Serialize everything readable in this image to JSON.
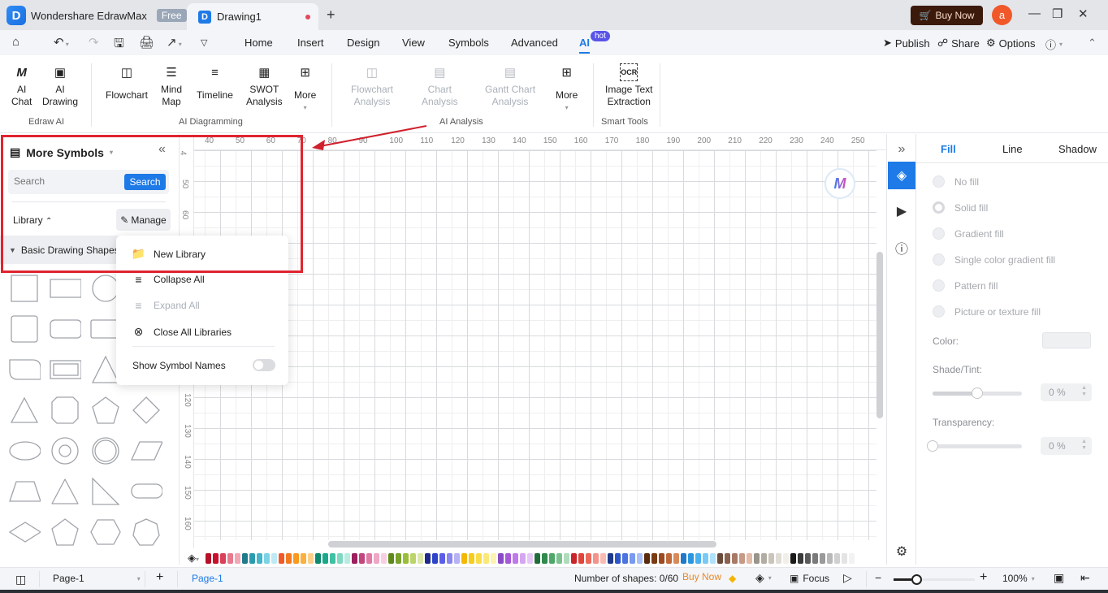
{
  "titlebar": {
    "app_name": "Wondershare EdrawMax",
    "free_badge": "Free",
    "doc_tab": "Drawing1",
    "buy_now": "Buy Now",
    "avatar_letter": "a"
  },
  "menubar": {
    "items": [
      "Home",
      "Insert",
      "Design",
      "View",
      "Symbols",
      "Advanced",
      "AI"
    ],
    "active": "AI",
    "hot_badge": "hot",
    "publish": "Publish",
    "share": "Share",
    "options": "Options"
  },
  "ribbon": {
    "edraw_ai": {
      "group": "Edraw AI",
      "ai_chat": "AI\nChat",
      "ai_chat_l1": "AI",
      "ai_chat_l2": "Chat",
      "ai_drawing_l1": "AI",
      "ai_drawing_l2": "Drawing"
    },
    "ai_diagramming": {
      "group": "AI Diagramming",
      "flowchart": "Flowchart",
      "mind_map_l1": "Mind",
      "mind_map_l2": "Map",
      "timeline": "Timeline",
      "swot_l1": "SWOT",
      "swot_l2": "Analysis",
      "more": "More"
    },
    "ai_analysis": {
      "group": "AI Analysis",
      "flowchart_l1": "Flowchart",
      "flowchart_l2": "Analysis",
      "chart_l1": "Chart",
      "chart_l2": "Analysis",
      "gantt_l1": "Gantt Chart",
      "gantt_l2": "Analysis",
      "more": "More"
    },
    "smart_tools": {
      "group": "Smart Tools",
      "ocr_l1": "Image Text",
      "ocr_l2": "Extraction"
    }
  },
  "left_panel": {
    "title": "More Symbols",
    "search_placeholder": "Search",
    "search_button": "Search",
    "library_label": "Library",
    "manage_button": "Manage",
    "library_name": "Basic Drawing Shapes"
  },
  "dropdown": {
    "items": [
      {
        "label": "New Library",
        "enabled": true
      },
      {
        "label": "Collapse All",
        "enabled": true
      },
      {
        "label": "Expand All",
        "enabled": false
      },
      {
        "label": "Close All Libraries",
        "enabled": true
      }
    ],
    "toggle_label": "Show Symbol Names",
    "toggle_on": false
  },
  "canvas": {
    "ruler_top": [
      "40",
      "50",
      "60",
      "70",
      "80",
      "90",
      "100",
      "110",
      "120",
      "130",
      "140",
      "150",
      "160",
      "170",
      "180",
      "190",
      "200",
      "210",
      "220",
      "230",
      "240",
      "250"
    ],
    "ruler_left": [
      "4",
      "50",
      "60",
      "120",
      "130",
      "140",
      "150",
      "160"
    ]
  },
  "palette": {
    "colors": [
      "#b7102a",
      "#c8102e",
      "#d9405a",
      "#e87a90",
      "#f2a7b5",
      "#1f7a8c",
      "#2a9bb0",
      "#45b5c9",
      "#7dd3e6",
      "#bfeaf5",
      "#f05a28",
      "#f47a20",
      "#f79a1e",
      "#fbb040",
      "#fcd08a",
      "#0f8a6f",
      "#19a88a",
      "#3fc1a3",
      "#7ed9c3",
      "#b8ece0",
      "#9c1f5e",
      "#c2467e",
      "#e07aa5",
      "#f0a6c6",
      "#f6d0e2",
      "#5e8a1a",
      "#7aa32a",
      "#9bbe3a",
      "#bcd46a",
      "#dbe8a8",
      "#1e2a8c",
      "#2e44c8",
      "#5a5ee8",
      "#8a86f0",
      "#b6b2f6",
      "#f5b800",
      "#f7cc1a",
      "#f9dc4a",
      "#fbe87a",
      "#fdf4b0",
      "#8a4ac8",
      "#a65ad8",
      "#c07ae8",
      "#d6a6f2",
      "#e6c8f8",
      "#1f6e3a",
      "#2f8a4e",
      "#4fa86a",
      "#7cc28e",
      "#b0dcbc",
      "#c8242a",
      "#e0443a",
      "#ec6a5c",
      "#f4938a",
      "#f9bcb4",
      "#1f3a8c",
      "#2e56c8",
      "#4a74e0",
      "#7a9af0",
      "#aac0f6",
      "#5a2a0a",
      "#7a3a12",
      "#9c4a20",
      "#be6a3a",
      "#d88a5a",
      "#1e7ac8",
      "#2a96e0",
      "#4ab2f0",
      "#7acaf6",
      "#b0e2fa",
      "#6a4a3a",
      "#8a6250",
      "#a87a66",
      "#c69a86",
      "#e2bca8",
      "#9a948a",
      "#b2aca2",
      "#cac4ba",
      "#e0dcd4",
      "#f2efea",
      "#1a1a1a",
      "#3a3a3a",
      "#5a5a5a",
      "#7a7a7a",
      "#9a9a9a",
      "#b8b8b8",
      "#d0d0d0",
      "#e4e4e4",
      "#f2f2f2",
      "#ffffff"
    ]
  },
  "right_panel": {
    "tabs": [
      "Fill",
      "Line",
      "Shadow"
    ],
    "active_tab": "Fill",
    "fill_options": [
      "No fill",
      "Solid fill",
      "Gradient fill",
      "Single color gradient fill",
      "Pattern fill",
      "Picture or texture fill"
    ],
    "selected_fill": "Solid fill",
    "color_label": "Color:",
    "shade_label": "Shade/Tint:",
    "shade_value": "0 %",
    "shade_slider_fraction": 0.5,
    "transparency_label": "Transparency:",
    "transparency_value": "0 %",
    "transparency_slider_fraction": 0.0
  },
  "statusbar": {
    "page_select": "Page-1",
    "page_tab": "Page-1",
    "shape_count": "Number of shapes: 0/60",
    "buy_now": "Buy Now",
    "focus": "Focus",
    "zoom": "100%",
    "zoom_fraction": 0.1
  },
  "colors": {
    "accent": "#1e7ae6",
    "highlight": "#e0242f",
    "buy_now_bg": "#3b1a0c",
    "avatar": "#f0582a"
  }
}
